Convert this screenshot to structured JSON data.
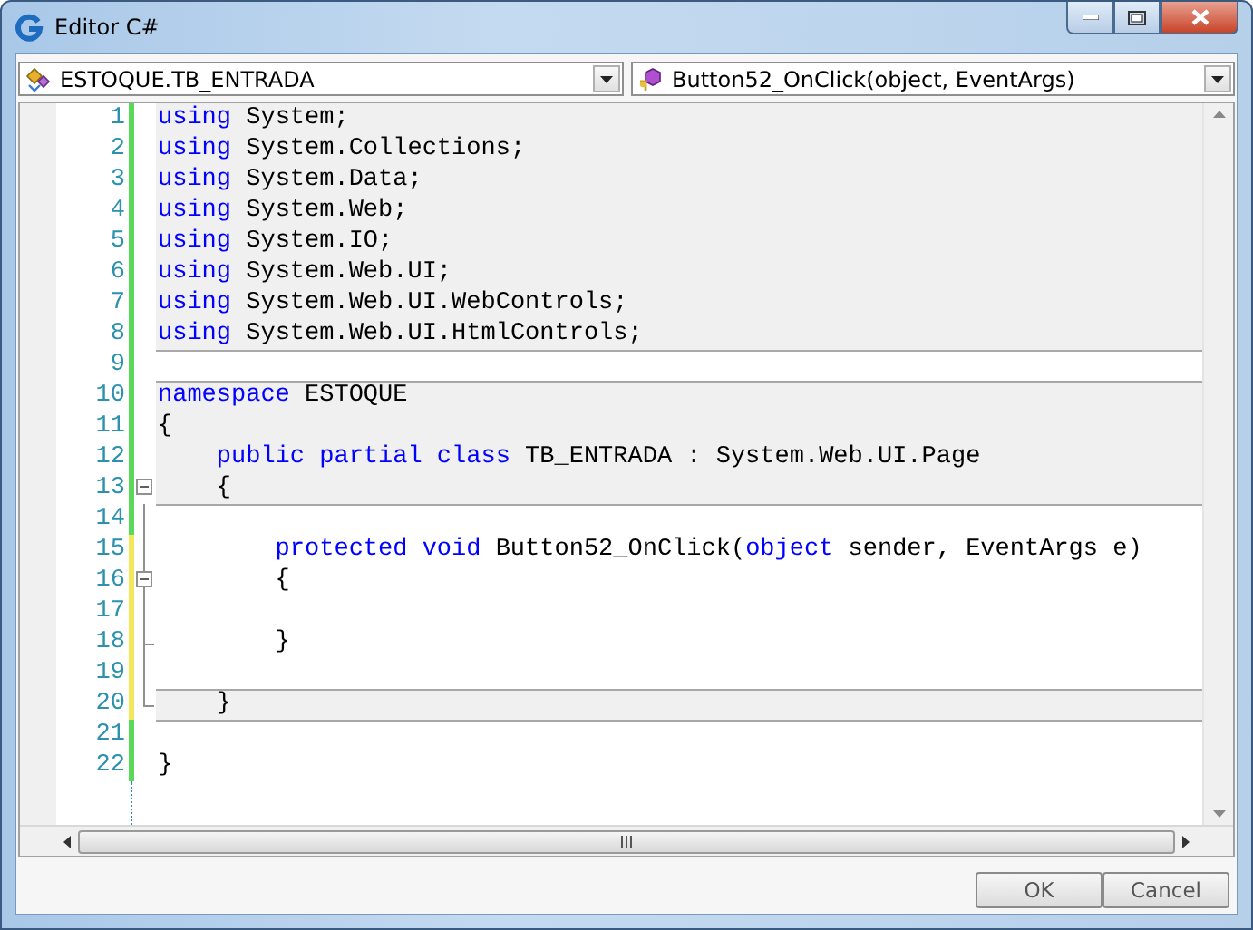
{
  "window": {
    "title": "Editor C#"
  },
  "selectors": [
    {
      "kind": "class",
      "value": "ESTOQUE.TB_ENTRADA"
    },
    {
      "kind": "method",
      "value": "Button52_OnClick(object, EventArgs)"
    }
  ],
  "lines": [
    {
      "number": "1",
      "kind": "plain",
      "color": "#5ad85a",
      "shaded": true,
      "tokens": [
        {
          "kind": "keyword",
          "text": "using"
        },
        {
          "kind": "plain",
          "text": " System;"
        }
      ]
    },
    {
      "number": "2",
      "kind": "plain",
      "color": "#5ad85a",
      "shaded": true,
      "tokens": [
        {
          "kind": "keyword",
          "text": "using"
        },
        {
          "kind": "plain",
          "text": " System.Collections;"
        }
      ]
    },
    {
      "number": "3",
      "kind": "plain",
      "color": "#5ad85a",
      "shaded": true,
      "tokens": [
        {
          "kind": "keyword",
          "text": "using"
        },
        {
          "kind": "plain",
          "text": " System.Data;"
        }
      ]
    },
    {
      "number": "4",
      "kind": "plain",
      "color": "#5ad85a",
      "shaded": true,
      "tokens": [
        {
          "kind": "keyword",
          "text": "using"
        },
        {
          "kind": "plain",
          "text": " System.Web;"
        }
      ]
    },
    {
      "number": "5",
      "kind": "plain",
      "color": "#5ad85a",
      "shaded": true,
      "tokens": [
        {
          "kind": "keyword",
          "text": "using"
        },
        {
          "kind": "plain",
          "text": " System.IO;"
        }
      ]
    },
    {
      "number": "6",
      "kind": "plain",
      "color": "#5ad85a",
      "shaded": true,
      "tokens": [
        {
          "kind": "keyword",
          "text": "using"
        },
        {
          "kind": "plain",
          "text": " System.Web.UI;"
        }
      ]
    },
    {
      "number": "7",
      "kind": "plain",
      "color": "#5ad85a",
      "shaded": true,
      "tokens": [
        {
          "kind": "keyword",
          "text": "using"
        },
        {
          "kind": "plain",
          "text": " System.Web.UI.WebControls;"
        }
      ]
    },
    {
      "number": "8",
      "kind": "plain",
      "color": "#5ad85a",
      "shaded": true,
      "tokens": [
        {
          "kind": "keyword",
          "text": "using"
        },
        {
          "kind": "plain",
          "text": " System.Web.UI.HtmlControls;"
        }
      ]
    },
    {
      "number": "9",
      "kind": "plain",
      "color": "#5ad85a",
      "shaded": false
    },
    {
      "number": "10",
      "kind": "plain",
      "color": "#5ad85a",
      "shaded": true,
      "tokens": [
        {
          "kind": "keyword",
          "text": "namespace"
        },
        {
          "kind": "plain",
          "text": " ESTOQUE"
        }
      ]
    },
    {
      "number": "11",
      "kind": "plain",
      "color": "#5ad85a",
      "shaded": true,
      "tokens": [
        {
          "kind": "plain",
          "text": "{"
        }
      ]
    },
    {
      "number": "12",
      "kind": "plain",
      "color": "#5ad85a",
      "shaded": true,
      "tokens": [
        {
          "kind": "keyword",
          "text": "    public partial class"
        },
        {
          "kind": "plain",
          "text": " TB_ENTRADA : System.Web.UI.Page"
        }
      ]
    },
    {
      "number": "13",
      "kind": "opener",
      "color": "#5ad85a",
      "shaded": true,
      "tokens": [
        {
          "kind": "plain",
          "text": "    {"
        }
      ]
    },
    {
      "number": "14",
      "kind": "plain",
      "color": "#5ad85a",
      "shaded": false
    },
    {
      "number": "15",
      "kind": "plain",
      "color": "#f4e75a",
      "shaded": false,
      "tokens": [
        {
          "kind": "keyword",
          "text": "        protected void"
        },
        {
          "kind": "plain",
          "text": " Button52_OnClick("
        },
        {
          "kind": "keyword",
          "text": "object"
        },
        {
          "kind": "plain",
          "text": " sender, EventArgs e)"
        }
      ]
    },
    {
      "number": "16",
      "kind": "opener",
      "color": "#f4e75a",
      "shaded": false,
      "tokens": [
        {
          "kind": "plain",
          "text": "        {"
        }
      ]
    },
    {
      "number": "17",
      "kind": "plain",
      "color": "#f4e75a",
      "shaded": false
    },
    {
      "number": "18",
      "kind": "closer",
      "color": "#f4e75a",
      "shaded": false,
      "tokens": [
        {
          "kind": "plain",
          "text": "        }"
        }
      ]
    },
    {
      "number": "19",
      "kind": "plain",
      "color": "#f4e75a",
      "shaded": false
    },
    {
      "number": "20",
      "kind": "closer",
      "color": "#f4e75a",
      "shaded": true,
      "tokens": [
        {
          "kind": "plain",
          "text": "    }"
        }
      ]
    },
    {
      "number": "21",
      "kind": "plain",
      "color": "#5ad85a",
      "shaded": false
    },
    {
      "number": "22",
      "kind": "plain",
      "color": "#5ad85a",
      "shaded": false,
      "tokens": [
        {
          "kind": "plain",
          "text": "}"
        }
      ]
    }
  ],
  "buttons": [
    {
      "label": "OK"
    },
    {
      "label": "Cancel"
    }
  ]
}
